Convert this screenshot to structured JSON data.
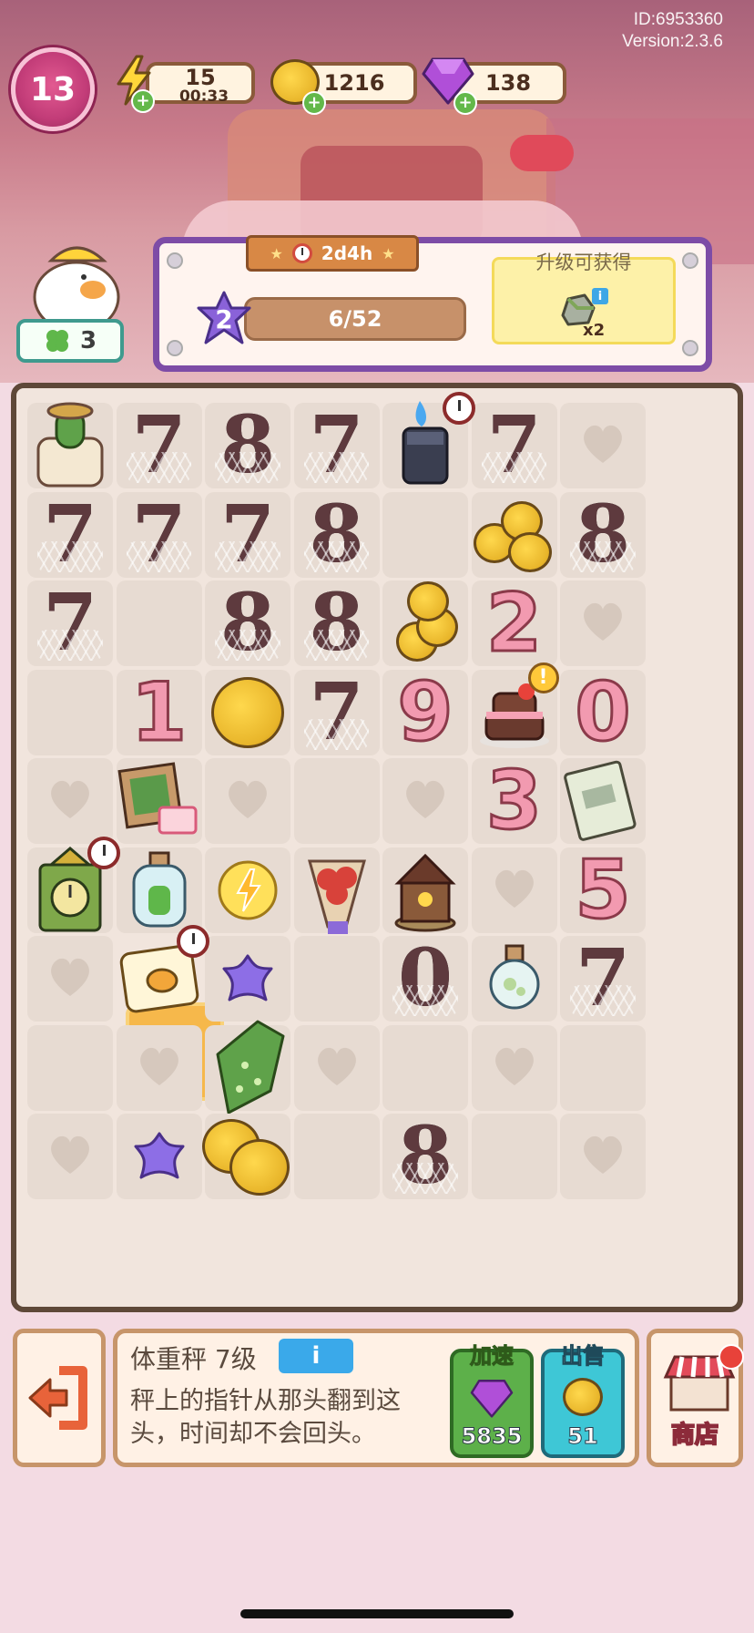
{
  "header": {
    "account_id": "ID:6953360",
    "version": "Version:2.3.6",
    "player_level": "13",
    "energy": {
      "value": "15",
      "timer": "00:33",
      "icon": "lightning-icon"
    },
    "coins": {
      "value": "1216",
      "icon": "coin-icon"
    },
    "gems": {
      "value": "138",
      "icon": "gem-icon"
    }
  },
  "clover": {
    "count": "3",
    "icon": "clover-icon"
  },
  "order": {
    "timer": "2d4h",
    "level": "2",
    "progress_text": "6/52",
    "progress_fraction": 0.115,
    "reward_title": "升级可获得",
    "reward_count": "x2",
    "reward_icon": "rock-icon"
  },
  "board": {
    "rows": [
      [
        "cactus-jar",
        "web-7",
        "web-8",
        "web-7",
        "lighter",
        "web-7",
        "heart"
      ],
      [
        "web-7",
        "web-7",
        "web-7",
        "web-8",
        "empty",
        "coins-stack",
        "web-8"
      ],
      [
        "web-7",
        "empty",
        "web-8",
        "web-8",
        "coins-tall",
        "pink-2",
        "heart"
      ],
      [
        "empty",
        "pink-1",
        "coin",
        "web-7",
        "pink-9",
        "cake",
        "pink-0"
      ],
      [
        "heart",
        "gift-box",
        "heart",
        "empty",
        "heart",
        "pink-3",
        "notebook"
      ],
      [
        "green-clock",
        "bottle",
        "energy-coin",
        "bouquet",
        "music-box",
        "heart",
        "pink-5"
      ],
      [
        "heart",
        "scale",
        "purple-star",
        "empty",
        "web-0",
        "bulb",
        "web-7"
      ],
      [
        "empty",
        "heart",
        "leaf-bag",
        "heart",
        "empty",
        "heart",
        "empty"
      ],
      [
        "heart",
        "purple-star",
        "coins-pair",
        "empty",
        "web-8",
        "empty",
        "heart"
      ]
    ],
    "selected": "scale"
  },
  "item_info": {
    "name": "体重秤 7级",
    "info_label": "i",
    "description": "秤上的指针从那头翻到这头，时间却不会回头。"
  },
  "actions": {
    "speedup": {
      "label": "加速",
      "value": "5835",
      "icon": "gem-icon"
    },
    "sell": {
      "label": "出售",
      "value": "51",
      "icon": "coin-icon"
    },
    "shop": {
      "label": "商店",
      "icon": "shop-icon"
    }
  },
  "colors": {
    "panel_border": "#7d4ca6",
    "board_border": "#5e4838",
    "speedup_green": "#5db04a",
    "sell_teal": "#3ec7d6",
    "level_pink": "#c23c78"
  }
}
